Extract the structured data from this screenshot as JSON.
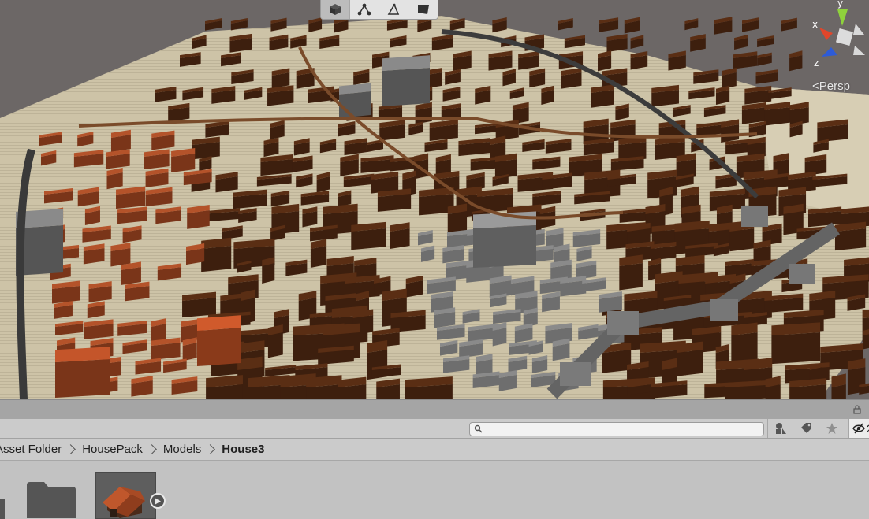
{
  "scene_view": {
    "camera_mode": "Persp",
    "axis_labels": {
      "x": "x",
      "y": "y",
      "z": "z"
    },
    "axis_colors": {
      "x": "#e0462b",
      "y": "#8fd23c",
      "z": "#2d5bd7"
    },
    "tools": [
      {
        "name": "cube-mode-icon",
        "active": true
      },
      {
        "name": "node-graph-icon",
        "active": false
      },
      {
        "name": "pen-tool-icon",
        "active": false
      },
      {
        "name": "flag-icon",
        "active": false
      }
    ]
  },
  "project": {
    "search": {
      "value": "",
      "placeholder": ""
    },
    "hidden_packages_count": "2",
    "breadcrumb": [
      "Asset Folder",
      "HousePack",
      "Models",
      "House3"
    ],
    "items": [
      {
        "type": "folder",
        "icon": "folder-icon"
      },
      {
        "type": "model",
        "icon": "house-model-thumbnail"
      }
    ]
  },
  "colors": {
    "roof": "#5a2e14",
    "roof_orange": "#b4532a",
    "ground": "#cfc5a9",
    "sky": "#6c6766",
    "stone": "#6e6e6e"
  }
}
